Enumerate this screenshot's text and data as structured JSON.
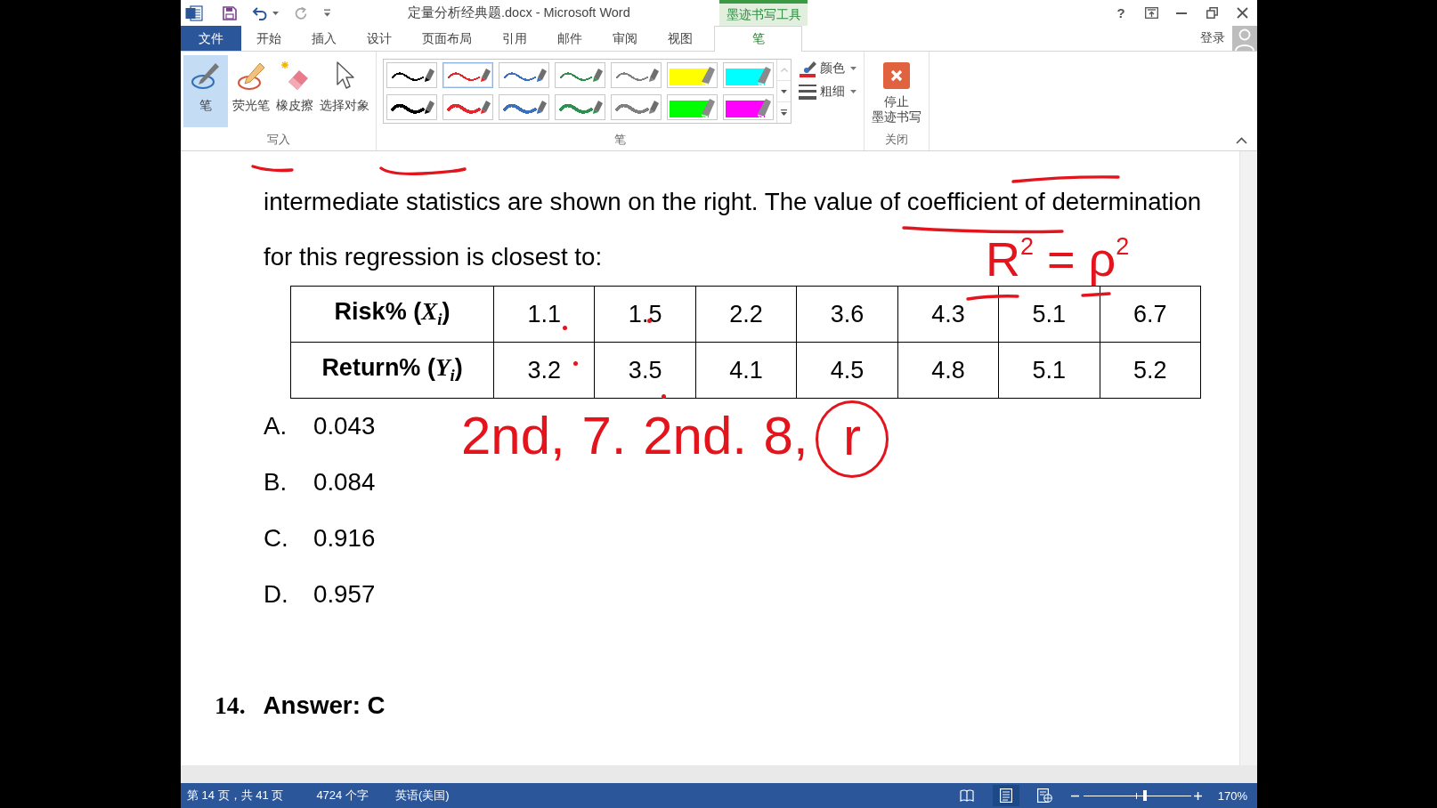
{
  "title_bar": {
    "quick_access": [
      {
        "kind": "save",
        "disabled": false
      },
      {
        "kind": "undo",
        "disabled": false
      },
      {
        "kind": "redo",
        "disabled": true
      }
    ],
    "title": "定量分析经典题.docx - Microsoft Word",
    "context_group": "墨迹书写工具",
    "help": "?"
  },
  "tabs": [
    {
      "label": "文件",
      "kind": "backstage",
      "selected": false
    },
    {
      "label": "开始",
      "kind": "tab",
      "selected": false
    },
    {
      "label": "插入",
      "kind": "tab",
      "selected": false
    },
    {
      "label": "设计",
      "kind": "tab",
      "selected": false
    },
    {
      "label": "页面布局",
      "kind": "tab",
      "selected": false
    },
    {
      "label": "引用",
      "kind": "tab",
      "selected": false
    },
    {
      "label": "邮件",
      "kind": "tab",
      "selected": false
    },
    {
      "label": "审阅",
      "kind": "tab",
      "selected": false
    },
    {
      "label": "视图",
      "kind": "tab",
      "selected": false
    },
    {
      "label": "笔",
      "kind": "contextual",
      "selected": true
    }
  ],
  "account": {
    "sign_in": "登录"
  },
  "ribbon": {
    "write": {
      "label": "写入",
      "tools": [
        {
          "label": "笔",
          "kind": "pen",
          "selected": true
        },
        {
          "label": "荧光笔",
          "kind": "highlighter",
          "selected": false
        },
        {
          "label": "橡皮擦",
          "kind": "eraser",
          "selected": false
        },
        {
          "label": "选择对象",
          "kind": "select",
          "selected": false
        }
      ]
    },
    "pens": {
      "label": "笔",
      "gallery": [
        {
          "kind": "fine",
          "color": "#000000",
          "selected": false
        },
        {
          "kind": "fine",
          "color": "#e0282e",
          "selected": true
        },
        {
          "kind": "fine",
          "color": "#3b6fbf",
          "selected": false
        },
        {
          "kind": "fine",
          "color": "#2f8f4e",
          "selected": false
        },
        {
          "kind": "fine",
          "color": "#808080",
          "selected": false
        },
        {
          "kind": "highlighter",
          "color": "#ffff00",
          "selected": false
        },
        {
          "kind": "highlighter",
          "color": "#00ffff",
          "selected": false
        },
        {
          "kind": "broad",
          "color": "#000000",
          "selected": false
        },
        {
          "kind": "broad",
          "color": "#e0282e",
          "selected": false
        },
        {
          "kind": "broad",
          "color": "#3b6fbf",
          "selected": false
        },
        {
          "kind": "broad",
          "color": "#2f8f4e",
          "selected": false
        },
        {
          "kind": "broad",
          "color": "#808080",
          "selected": false
        },
        {
          "kind": "highlighter",
          "color": "#00ff00",
          "selected": false
        },
        {
          "kind": "highlighter",
          "color": "#ff00ff",
          "selected": false
        }
      ],
      "scroll": [
        {
          "kind": "up",
          "disabled": true
        },
        {
          "kind": "down",
          "disabled": false
        },
        {
          "kind": "more",
          "disabled": false
        }
      ],
      "menus": [
        {
          "label": "颜色",
          "kind": "color"
        },
        {
          "label": "粗细",
          "kind": "weight"
        }
      ]
    },
    "close": {
      "label": "关闭",
      "button_lines": [
        "停止",
        "墨迹书写"
      ]
    }
  },
  "document": {
    "paragraph_lines": [
      "intermediate statistics are shown on the right. The value of coefficient of determination",
      "for this regression is closest to:"
    ],
    "table": {
      "rows": [
        {
          "header": "Risk% (*X*$_{i}$)",
          "cells": [
            "1.1",
            "1.5",
            "2.2",
            "3.6",
            "4.3",
            "5.1",
            "6.7"
          ]
        },
        {
          "header": "Return% (*Y*$_{i}$)",
          "cells": [
            "3.2",
            "3.5",
            "4.1",
            "4.5",
            "4.8",
            "5.1",
            "5.2"
          ]
        }
      ]
    },
    "options": [
      {
        "letter": "A.",
        "value": "0.043"
      },
      {
        "letter": "B.",
        "value": "0.084"
      },
      {
        "letter": "C.",
        "value": "0.916"
      },
      {
        "letter": "D.",
        "value": "0.957"
      }
    ],
    "answer": {
      "number": "14.",
      "text": "Answer: C"
    }
  },
  "ink": [
    {
      "kind": "plain",
      "text": "R$^{2}$ = ρ$^{2}$"
    },
    {
      "kind": "plain",
      "text": "2nd, 7. 2nd. 8,"
    },
    {
      "kind": "circled",
      "text": "r"
    }
  ],
  "status_bar": {
    "page": "第 14 页，共 41 页",
    "words": "4724 个字",
    "language": "英语(美国)",
    "views": [
      {
        "kind": "read",
        "selected": false
      },
      {
        "kind": "print",
        "selected": true
      },
      {
        "kind": "web",
        "selected": false
      }
    ],
    "zoom": {
      "level": 0.57,
      "label": "170%"
    }
  }
}
